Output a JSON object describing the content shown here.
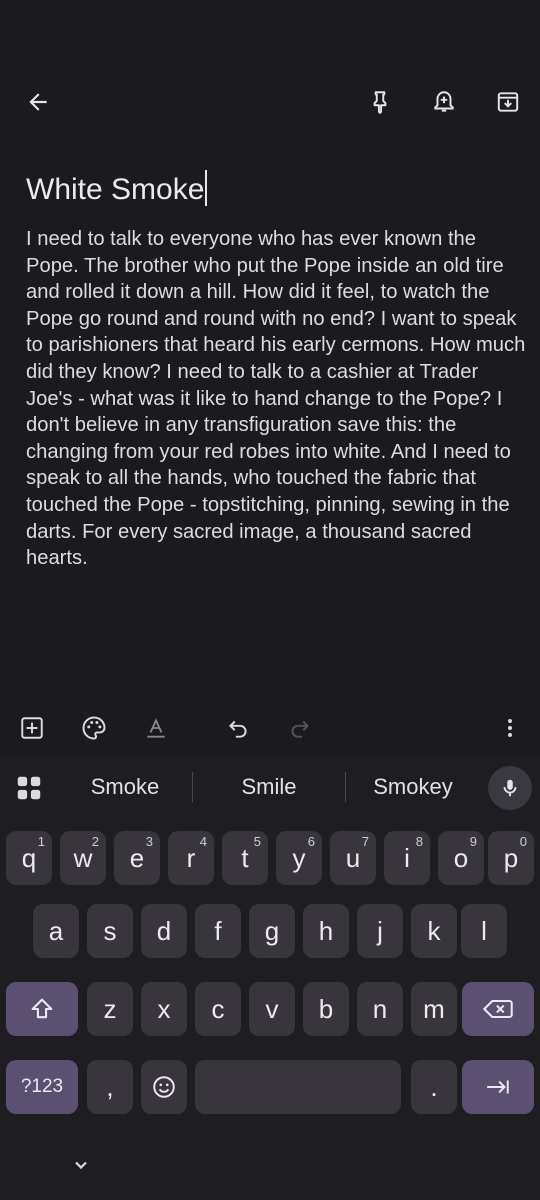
{
  "note": {
    "title": "White Smoke",
    "body": "I need to talk to everyone who has ever known the Pope. The brother who put the Pope inside an old tire and rolled it down a hill. How did it feel, to watch the Pope go round and round with no end? I want to speak to parishioners that heard his early cermons. How much did they know? I need to talk to a cashier at Trader Joe's - what was it like to hand change to the Pope? I don't believe in any transfiguration save this: the changing from your red robes into white. And I need to speak to all the hands, who touched the fabric that touched the Pope - topstitching, pinning, sewing in the darts. For every sacred image, a thousand sacred hearts."
  },
  "icons": {
    "back": "arrow-left-icon",
    "pin": "pin-icon",
    "reminder": "bell-plus-icon",
    "archive": "archive-icon",
    "add": "add-box-icon",
    "palette": "palette-icon",
    "text_format": "text-format-icon",
    "undo": "undo-icon",
    "redo": "redo-icon",
    "more": "more-vert-icon"
  },
  "keyboard": {
    "suggestions": [
      "Smoke",
      "Smile",
      "Smokey"
    ],
    "row1": [
      {
        "k": "q",
        "h": "1"
      },
      {
        "k": "w",
        "h": "2"
      },
      {
        "k": "e",
        "h": "3"
      },
      {
        "k": "r",
        "h": "4"
      },
      {
        "k": "t",
        "h": "5"
      },
      {
        "k": "y",
        "h": "6"
      },
      {
        "k": "u",
        "h": "7"
      },
      {
        "k": "i",
        "h": "8"
      },
      {
        "k": "o",
        "h": "9"
      },
      {
        "k": "p",
        "h": "0"
      }
    ],
    "row2": [
      "a",
      "s",
      "d",
      "f",
      "g",
      "h",
      "j",
      "k",
      "l"
    ],
    "row3": [
      "z",
      "x",
      "c",
      "v",
      "b",
      "n",
      "m"
    ],
    "symbols_label": "?123",
    "comma": ",",
    "period": "."
  },
  "colors": {
    "background": "#1b1a1f",
    "key": "#38363c",
    "accent_key": "#5b4f72"
  }
}
